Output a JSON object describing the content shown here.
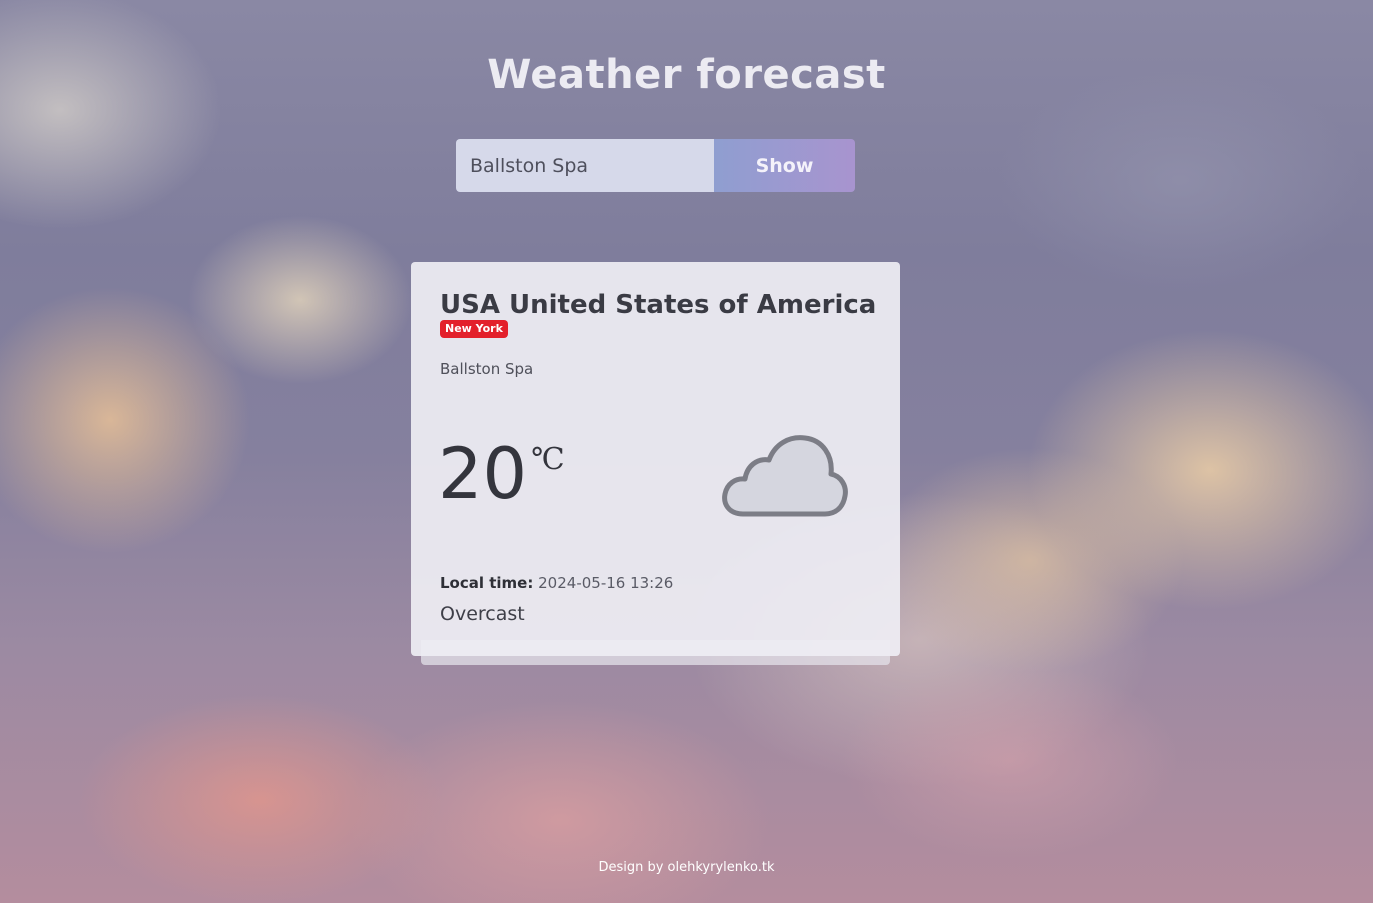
{
  "header": {
    "title": "Weather forecast"
  },
  "search": {
    "value": "Ballston Spa",
    "button_label": "Show"
  },
  "card": {
    "country": "USA United States of America",
    "region": "New York",
    "city": "Ballston Spa",
    "temperature": "20",
    "temperature_unit": "℃",
    "weather_icon": "cloud-icon",
    "local_time_label": "Local time:",
    "local_time_value": "2024-05-16 13:26",
    "condition": "Overcast"
  },
  "footer": {
    "text": "Design by olehkyrylenko.tk"
  },
  "colors": {
    "badge": "#e3202b",
    "button_gradient_start": "#8f9ed0",
    "button_gradient_end": "#a894cf",
    "input_background": "#d6d9ea"
  }
}
